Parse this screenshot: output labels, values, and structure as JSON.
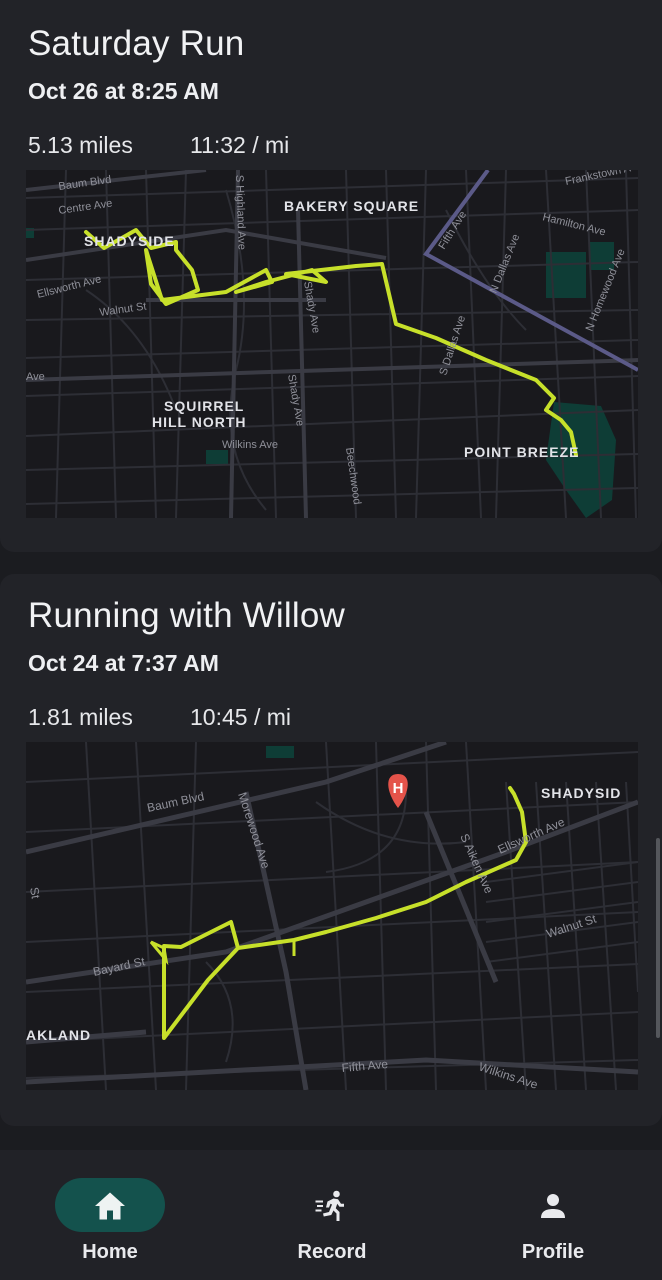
{
  "activities": [
    {
      "title": "Saturday Run",
      "date": "Oct 26 at 8:25 AM",
      "distance": "5.13 miles",
      "pace": "11:32 / mi",
      "map": {
        "labels": {
          "baum": "Baum Blvd",
          "centre": "Centre Ave",
          "shadyside": "SHADYSIDE",
          "ellsworth": "Ellsworth Ave",
          "walnut": "Walnut St",
          "ave": "Ave",
          "highland": "S Highland Ave",
          "bakery": "BAKERY SQUARE",
          "fifth": "Fifth Ave",
          "frankstown": "Frankstown A",
          "hamilton": "Hamilton Ave",
          "dallas": "N Dallas Ave",
          "homewood": "N Homewood Ave",
          "shadyave": "Shady Ave",
          "shadyave2": "Shady Ave",
          "sdallas": "S Dallas Ave",
          "squirrel1": "SQUIRREL",
          "squirrel2": "HILL NORTH",
          "wilkins": "Wilkins Ave",
          "beechwood": "Beechwood",
          "pointbreeze": "POINT BREEZE"
        }
      }
    },
    {
      "title": "Running with Willow",
      "date": "Oct 24 at 7:37 AM",
      "distance": "1.81 miles",
      "pace": "10:45 / mi",
      "map": {
        "labels": {
          "baum": "Baum Blvd",
          "morewood": "Morewood Ave",
          "shadyside": "SHADYSID",
          "ellsworth": "Ellsworth Ave",
          "saiken": "S Aiken Ave",
          "walnut": "Walnut St",
          "bayard": "Bayard St",
          "oakland": "AKLAND",
          "fifth": "Fifth Ave",
          "wilkins": "Wilkins Ave",
          "st": "St",
          "hospital": "H"
        }
      }
    }
  ],
  "nav": {
    "items": [
      {
        "label": "Home",
        "icon": "home-icon",
        "active": true
      },
      {
        "label": "Record",
        "icon": "running-icon",
        "active": false
      },
      {
        "label": "Profile",
        "icon": "person-icon",
        "active": false
      }
    ]
  },
  "colors": {
    "route": "#c7e02a",
    "accent": "#14524d",
    "park": "#0e3d36",
    "hospital_pin": "#e4534a"
  }
}
